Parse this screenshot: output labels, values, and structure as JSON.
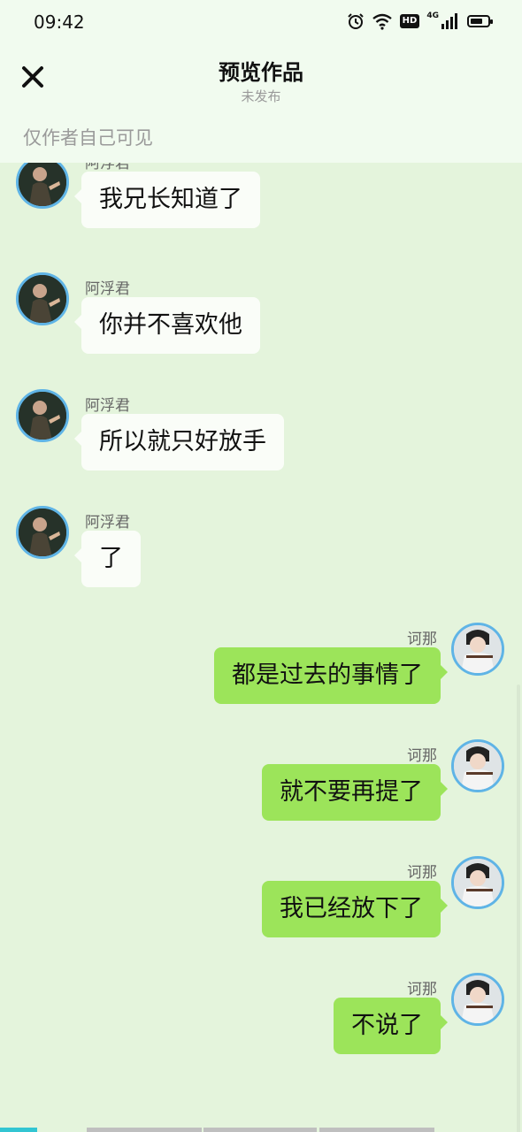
{
  "status_bar": {
    "time": "09:42",
    "network_label": "4G",
    "hd_label": "HD",
    "battery_level": 0.7,
    "icons": [
      "alarm-icon",
      "wifi-icon",
      "hd-icon",
      "signal-icon",
      "battery-icon"
    ]
  },
  "header": {
    "close_icon": "close-icon",
    "title": "预览作品",
    "subtitle": "未发布",
    "visibility_note": "仅作者自己可见"
  },
  "colors": {
    "background": "#e4f4dc",
    "header_bg": "#f1fbef",
    "incoming_bubble": "#fafdf8",
    "outgoing_bubble": "#9ce45a",
    "avatar_ring": "#5fb4e6"
  },
  "messages": [
    {
      "side": "left",
      "sender": "阿浮君",
      "text": "我兄长知道了"
    },
    {
      "side": "left",
      "sender": "阿浮君",
      "text": "你并不喜欢他"
    },
    {
      "side": "left",
      "sender": "阿浮君",
      "text": "所以就只好放手"
    },
    {
      "side": "left",
      "sender": "阿浮君",
      "text": "了"
    },
    {
      "side": "right",
      "sender": "诃那",
      "text": "都是过去的事情了"
    },
    {
      "side": "right",
      "sender": "诃那",
      "text": "就不要再提了"
    },
    {
      "side": "right",
      "sender": "诃那",
      "text": "我已经放下了"
    },
    {
      "side": "right",
      "sender": "诃那",
      "text": "不说了"
    }
  ]
}
